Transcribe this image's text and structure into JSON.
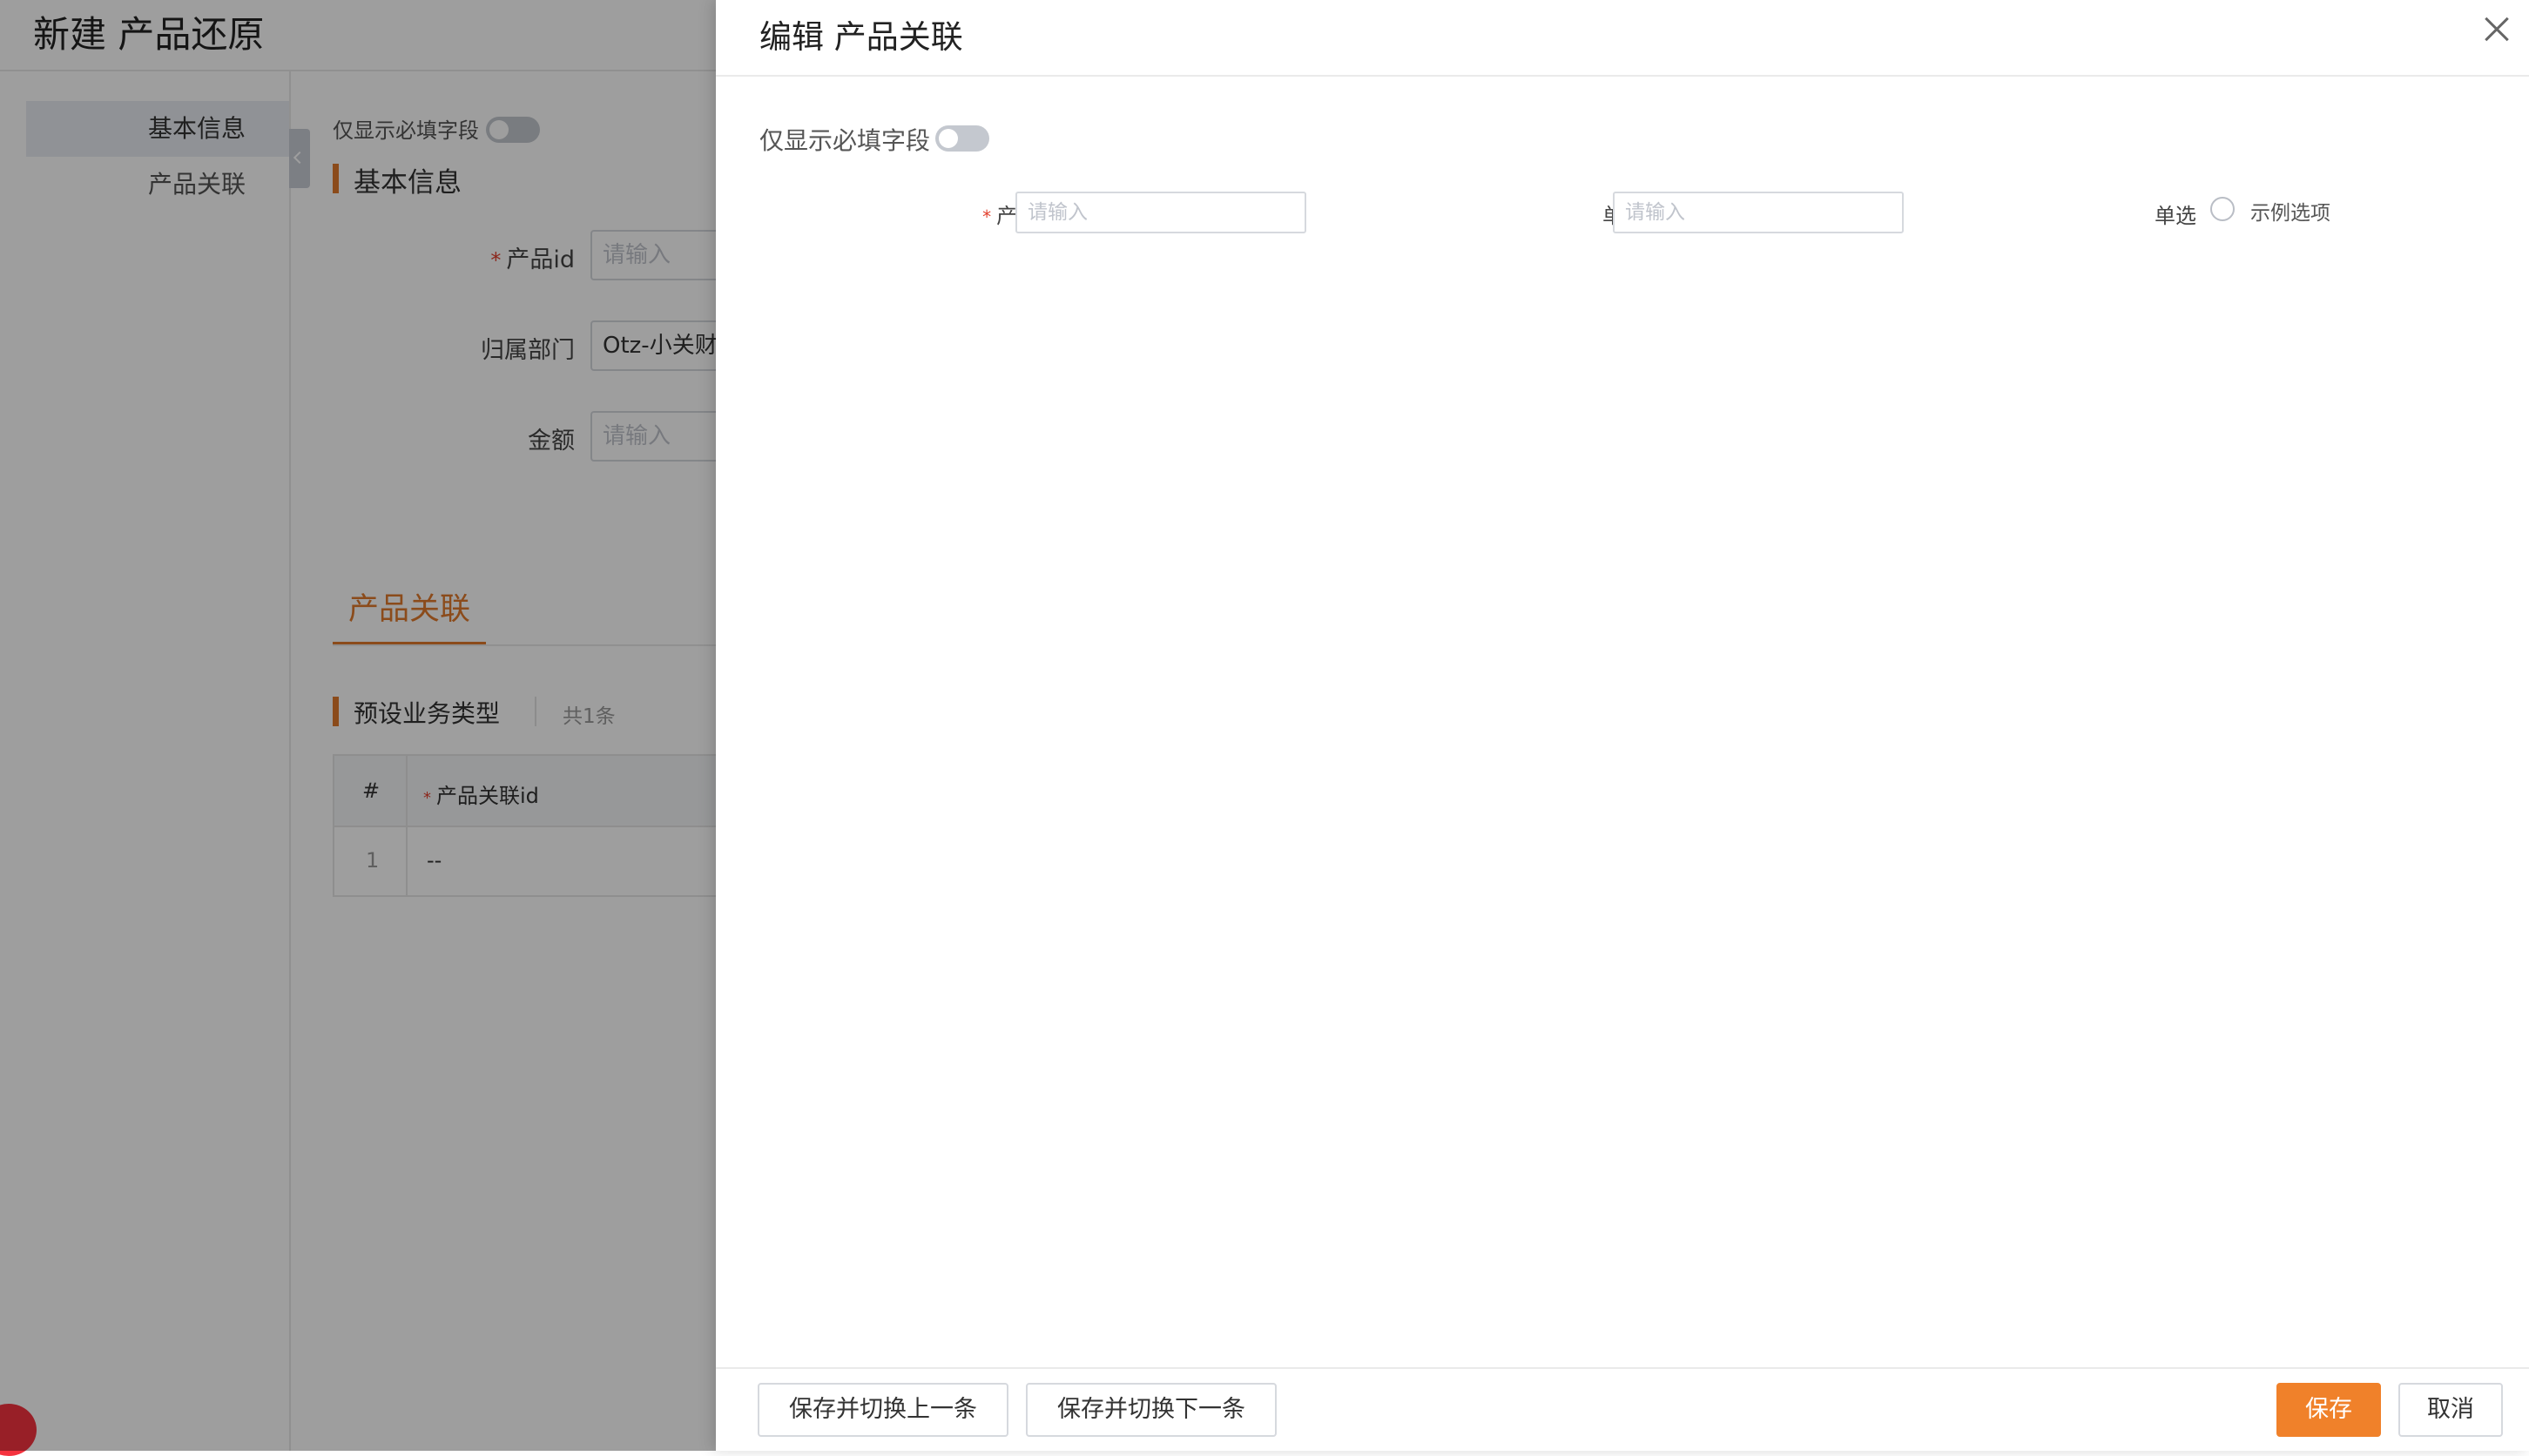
{
  "page": {
    "title": "新建 产品还原",
    "side_nav": [
      "基本信息",
      "产品关联"
    ],
    "required_only_label": "仅显示必填字段",
    "basic_section_title": "基本信息",
    "fields": [
      {
        "label": "产品id",
        "required": true,
        "value": "",
        "placeholder": "请输入"
      },
      {
        "label": "归属部门",
        "required": false,
        "value": "Otz-小关财务",
        "placeholder": ""
      },
      {
        "label": "金额",
        "required": false,
        "value": "",
        "placeholder": "请输入"
      }
    ],
    "tab_label": "产品关联",
    "preset_title": "预设业务类型",
    "preset_count": "共1条",
    "table": {
      "headers": [
        "#",
        "产品关联id"
      ],
      "rows": [
        [
          "1",
          "--"
        ]
      ]
    }
  },
  "drawer": {
    "title": "编辑 产品关联",
    "required_only_label": "仅显示必填字段",
    "fields": {
      "product_link_id": {
        "label": "产品关联id",
        "placeholder": "请输入",
        "required": true
      },
      "single_line_text": {
        "label": "单行文本",
        "placeholder": "请输入"
      },
      "single_choice": {
        "label": "单选",
        "option": "示例选项"
      }
    },
    "buttons": {
      "save_prev": "保存并切换上一条",
      "save_next": "保存并切换下一条",
      "save": "保存",
      "cancel": "取消"
    }
  },
  "colors": {
    "accent": "#f0812a",
    "required": "#e2402e"
  }
}
